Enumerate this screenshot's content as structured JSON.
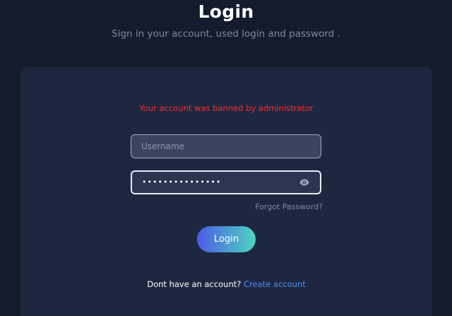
{
  "header": {
    "title": "Login",
    "subtitle": "Sign in your account, used login and password ."
  },
  "form": {
    "error_message": "Your account was banned by administrator",
    "username": {
      "placeholder": "Username",
      "value": ""
    },
    "password": {
      "value": "•••••••••••••••",
      "toggle_icon": "eye-icon"
    },
    "forgot_label": "Forgot Password?",
    "submit_label": "Login",
    "signup_prompt": "Dont have an account?",
    "signup_link": "Create account"
  },
  "colors": {
    "background": "#141b2d",
    "card": "#1d2740",
    "error": "#ff2b2b",
    "link": "#4f8ef7",
    "button_gradient_start": "#4a5be6",
    "button_gradient_end": "#4fd6c4"
  }
}
